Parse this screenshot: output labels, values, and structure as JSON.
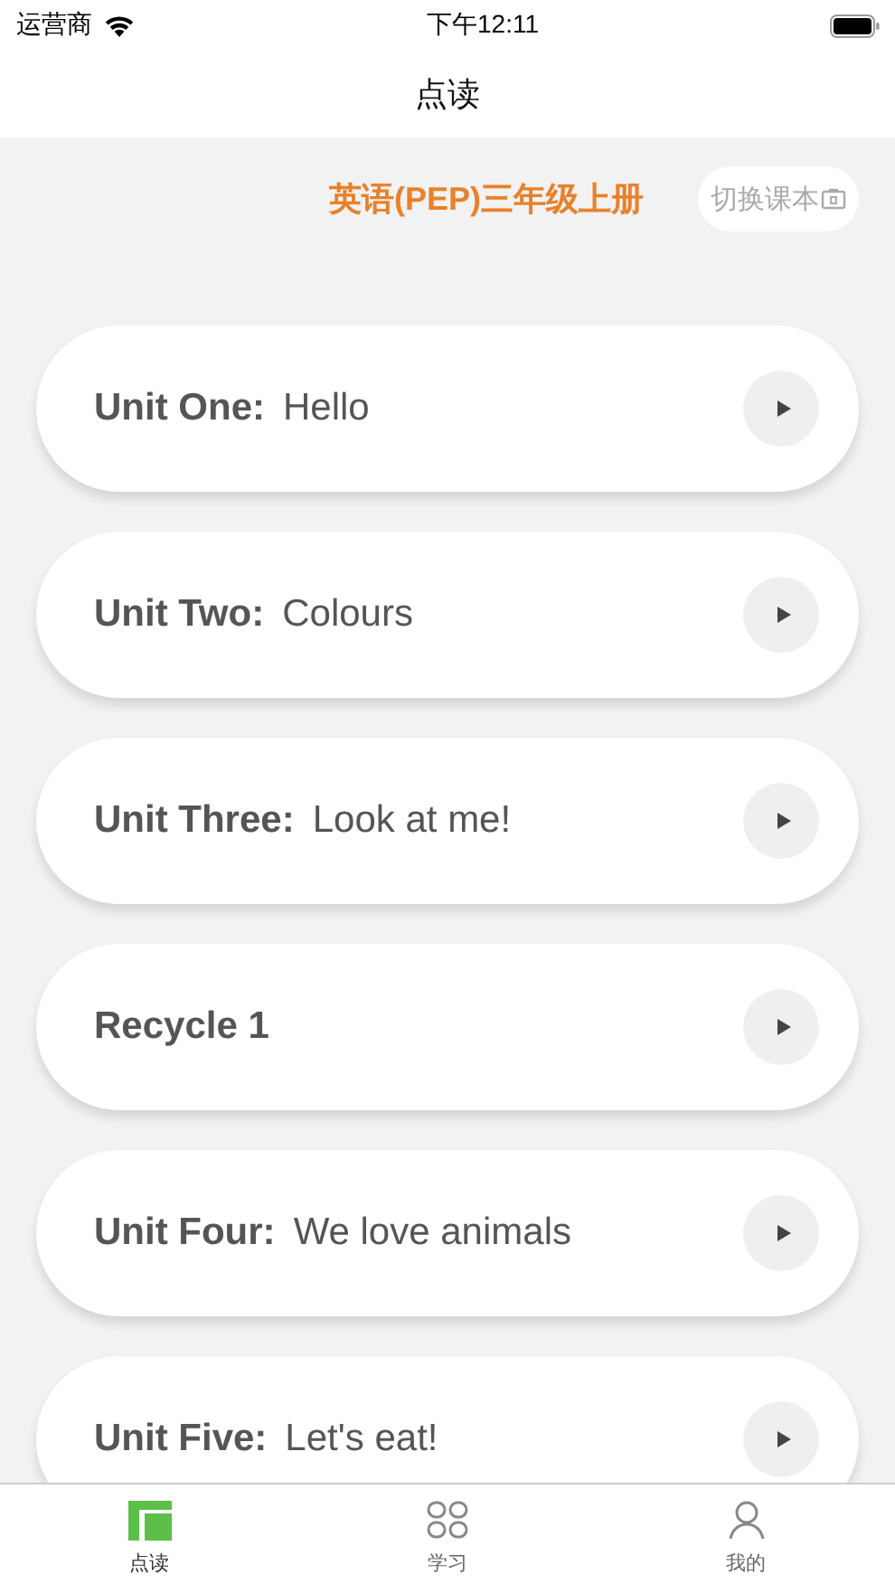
{
  "status_bar": {
    "carrier": "运营商",
    "time": "下午12:11"
  },
  "nav": {
    "title": "点读"
  },
  "book": {
    "title": "英语(PEP)三年级上册",
    "switch_label": "切换课本"
  },
  "units": [
    {
      "name": "Unit One:",
      "topic": "Hello"
    },
    {
      "name": "Unit Two:",
      "topic": "Colours"
    },
    {
      "name": "Unit Three:",
      "topic": "Look at me!"
    },
    {
      "name": "Recycle 1"
    },
    {
      "name": "Unit Four:",
      "topic": "We love animals"
    },
    {
      "name": "Unit Five:",
      "topic": "Let's eat!"
    }
  ],
  "tab_bar": [
    {
      "label": "点读",
      "kind": "read",
      "selected": true
    },
    {
      "label": "学习",
      "kind": "learn",
      "selected": false
    },
    {
      "label": "我的",
      "kind": "me",
      "selected": false
    }
  ]
}
